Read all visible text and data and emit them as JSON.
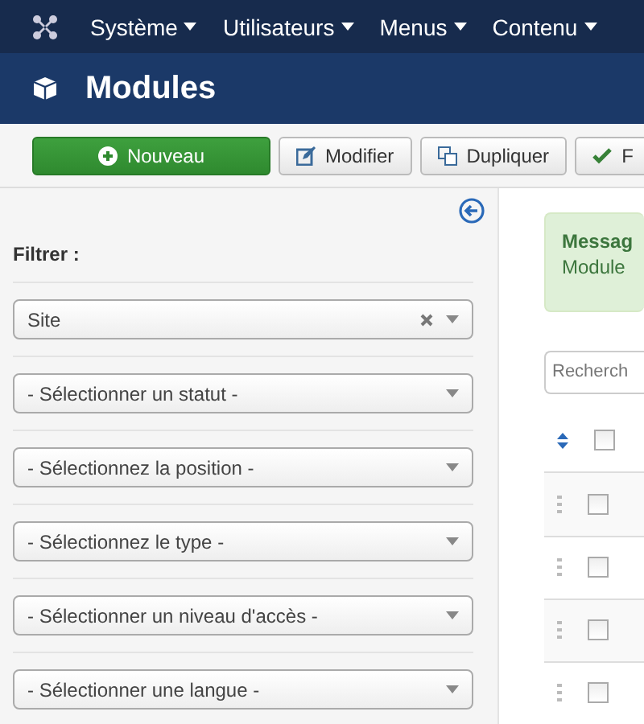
{
  "menu_bar": {
    "items": [
      {
        "label": "Système"
      },
      {
        "label": "Utilisateurs"
      },
      {
        "label": "Menus"
      },
      {
        "label": "Contenu"
      }
    ]
  },
  "header": {
    "title": "Modules"
  },
  "toolbar": {
    "buttons": [
      {
        "label": "Nouveau",
        "kind": "new"
      },
      {
        "label": "Modifier",
        "kind": "edit"
      },
      {
        "label": "Dupliquer",
        "kind": "copy"
      },
      {
        "label": "F",
        "kind": "publish"
      }
    ]
  },
  "sidebar": {
    "title": "Filtrer :",
    "filters": [
      {
        "value": "Site",
        "clearable": true
      },
      {
        "value": "- Sélectionner un statut -",
        "clearable": false
      },
      {
        "value": "- Sélectionnez la position -",
        "clearable": false
      },
      {
        "value": "- Sélectionnez le type -",
        "clearable": false
      },
      {
        "value": "- Sélectionner un niveau d'accès -",
        "clearable": false
      },
      {
        "value": "- Sélectionner une langue -",
        "clearable": false
      }
    ]
  },
  "message": {
    "title": "Messag",
    "text": "Module"
  },
  "search": {
    "placeholder": "Recherch"
  },
  "table": {
    "header": {
      "checked": false
    },
    "rows": [
      {
        "checked": false
      },
      {
        "checked": false
      },
      {
        "checked": false
      },
      {
        "checked": false
      }
    ]
  }
}
